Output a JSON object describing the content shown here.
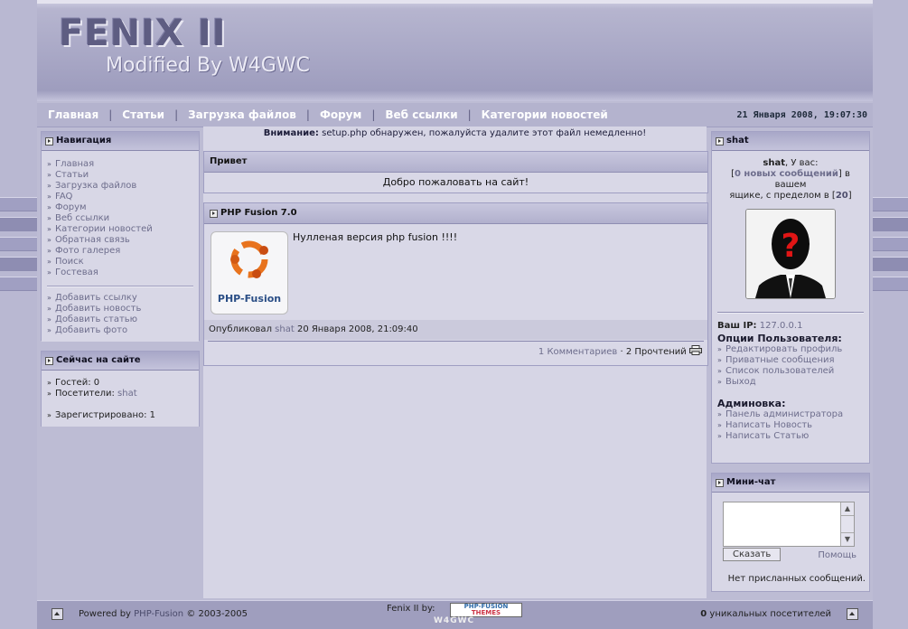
{
  "header": {
    "logo_main": "FENIX II",
    "logo_sub": "Modified By W4GWC"
  },
  "nav": {
    "items": [
      "Главная",
      "Статьи",
      "Загрузка файлов",
      "Форум",
      "Веб ссылки",
      "Категории новостей"
    ],
    "separator": "|",
    "date": "21 Января 2008, 19:07:30"
  },
  "left": {
    "navigation": {
      "title": "Навигация",
      "links": [
        "Главная",
        "Статьи",
        "Загрузка файлов",
        "FAQ",
        "Форум",
        "Веб ссылки",
        "Категории новостей",
        "Обратная связь",
        "Фото галерея",
        "Поиск",
        "Гостевая"
      ],
      "submit_links": [
        "Добавить ссылку",
        "Добавить новость",
        "Добавить статью",
        "Добавить фото"
      ]
    },
    "online": {
      "title": "Сейчас на сайте",
      "guests_label": "Гостей: 0",
      "members_label": "Посетители:",
      "members_value": "shat",
      "registered": "Зарегистрировано: 1"
    }
  },
  "center": {
    "warning_bold": "Внимание:",
    "warning_text": " setup.php обнаружен, пожалуйста удалите этот файл немедленно!",
    "welcome": {
      "title": "Привет",
      "text": "Добро пожаловать на сайт!"
    },
    "news": {
      "title": "PHP Fusion 7.0",
      "image_caption": "PHP-Fusion",
      "body": "Нулленая версия php fusion !!!!",
      "posted_prefix": "Опубликовал",
      "posted_by": "shat",
      "posted_date": "20 Января 2008, 21:09:40",
      "comments": "1 Комментариев",
      "dot": "·",
      "reads": "2 Прочтений"
    }
  },
  "right": {
    "user": {
      "title": "shat",
      "greeting_name": "shat",
      "greeting_rest": ", У вас:",
      "new_messages": "0 новых сообщений",
      "mailbox_text1": "] в вашем",
      "mailbox_text2": "ящике, с пределом в [",
      "limit": "20",
      "ip_label": "Ваш IP:",
      "ip_value": "127.0.0.1",
      "options_title": "Опции Пользователя:",
      "options": [
        "Редактировать профиль",
        "Приватные сообщения",
        "Список пользователей",
        "Выход"
      ],
      "admin_title": "Админовка:",
      "admin_links": [
        "Панель администратора",
        "Написать Новость",
        "Написать Статью"
      ]
    },
    "shoutbox": {
      "title": "Мини-чат",
      "button": "Сказать",
      "help": "Помощь",
      "empty": "Нет присланных сообщений."
    }
  },
  "footer": {
    "powered_prefix": "Powered by",
    "powered_link": "PHP-Fusion",
    "powered_suffix": "© 2003-2005",
    "theme_by": "Fenix II by:",
    "badge_top": "PHP-FUSION",
    "badge_bottom": "THEMES",
    "w4gwc": "W4GWC",
    "visitors_count": "0",
    "visitors_label": " уникальных посетителей"
  },
  "colors": {
    "accent_link": "#6d6d8c",
    "nav_bg": "#b4b3ce",
    "panel_bg": "#d8d7e6"
  }
}
